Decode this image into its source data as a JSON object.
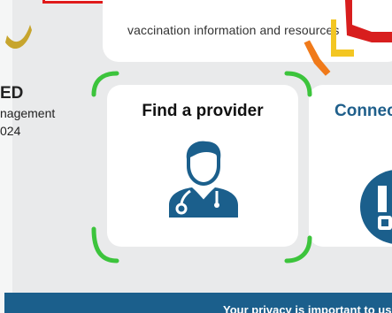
{
  "intro": {
    "text": "vaccination information and resources"
  },
  "sidebar": {
    "title": "ED",
    "line1": "nagement",
    "line2": "024"
  },
  "cards": {
    "provider": {
      "title": "Find a provider",
      "icon": "doctor-stethoscope-icon"
    },
    "connect": {
      "title": "Connect",
      "icon": "connect-info-icon"
    }
  },
  "footer": {
    "text": "Your privacy is important to us"
  },
  "colors": {
    "background": "#e9eaeb",
    "card": "#ffffff",
    "accent_blue": "#1b5f8c",
    "focus_green": "#3cc43c",
    "brand_red": "#e01b1b",
    "brand_orange": "#f07a1a",
    "brand_yellow": "#f3c622"
  }
}
